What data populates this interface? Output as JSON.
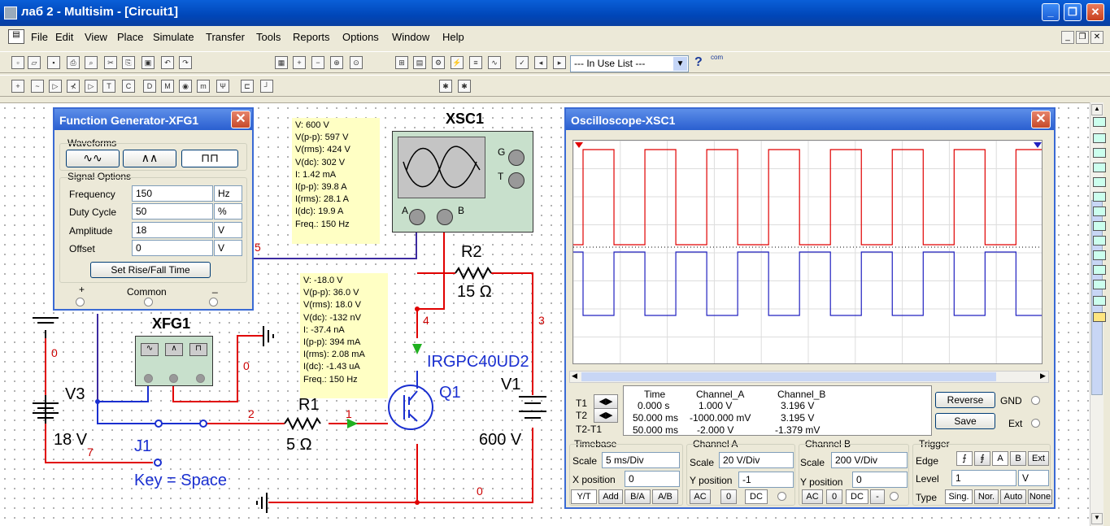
{
  "app": {
    "title": "лаб 2 - Multisim - [Circuit1]"
  },
  "menu": [
    "File",
    "Edit",
    "View",
    "Place",
    "Simulate",
    "Transfer",
    "Tools",
    "Reports",
    "Options",
    "Window",
    "Help"
  ],
  "toolbar": {
    "in_use_list": "--- In Use List ---",
    "help": "?",
    "com": "com"
  },
  "fg": {
    "title": "Function Generator-XFG1",
    "waveforms_label": "Waveforms",
    "signal_options_label": "Signal Options",
    "rows": [
      {
        "label": "Frequency",
        "value": "150",
        "unit": "Hz"
      },
      {
        "label": "Duty Cycle",
        "value": "50",
        "unit": "%"
      },
      {
        "label": "Amplitude",
        "value": "18",
        "unit": "V"
      },
      {
        "label": "Offset",
        "value": "0",
        "unit": "V"
      }
    ],
    "rise_fall": "Set Rise/Fall Time",
    "plus": "+",
    "common": "Common",
    "minus": "_"
  },
  "probe1": [
    "V: 600 V",
    "V(p-p): 597 V",
    "V(rms): 424 V",
    "V(dc): 302 V",
    "I: 1.42 mA",
    "I(p-p): 39.8 A",
    "I(rms): 28.1 A",
    "I(dc): 19.9 A",
    "Freq.: 150 Hz"
  ],
  "probe2": [
    "V: -18.0 V",
    "V(p-p): 36.0 V",
    "V(rms): 18.0 V",
    "V(dc): -132 nV",
    "I: -37.4 nA",
    "I(p-p): 394 mA",
    "I(rms): 2.08 mA",
    "I(dc): -1.43 uA",
    "Freq.: 150 Hz"
  ],
  "circuit": {
    "xsc1": "XSC1",
    "g": "G",
    "t": "T",
    "a": "A",
    "b": "B",
    "r2": "R2",
    "r2v": "15 Ω",
    "xfg1": "XFG1",
    "r1": "R1",
    "r1v": "5 Ω",
    "v3": "V3",
    "v3v": "18 V",
    "v1": "V1",
    "v1v": "600 V",
    "j1": "J1",
    "key": "Key = Space",
    "q1": "Q1",
    "q1model": "IRGPC40UD2",
    "nodes": {
      "n5": "5",
      "n4": "4",
      "n3": "3",
      "n0a": "0",
      "n0b": "0",
      "n0c": "0",
      "n2": "2",
      "n1": "1",
      "n7": "7"
    }
  },
  "scope": {
    "title": "Oscilloscope-XSC1",
    "headers": [
      "Time",
      "Channel_A",
      "Channel_B"
    ],
    "rows": [
      {
        "label": "T1",
        "time": "0.000 s",
        "a": "1.000 V",
        "b": "3.196 V"
      },
      {
        "label": "T2",
        "time": "50.000 ms",
        "a": "-1000.000 mV",
        "b": "3.195 V"
      },
      {
        "label": "T2-T1",
        "time": "50.000 ms",
        "a": "-2.000 V",
        "b": "-1.379 mV"
      }
    ],
    "reverse": "Reverse",
    "save": "Save",
    "gnd": "GND",
    "ext": "Ext",
    "timebase": {
      "label": "Timebase",
      "scale_label": "Scale",
      "scale": "5 ms/Div",
      "xpos_label": "X position",
      "xpos": "0",
      "buttons": [
        "Y/T",
        "Add",
        "B/A",
        "A/B"
      ]
    },
    "cha": {
      "label": "Channel A",
      "scale_label": "Scale",
      "scale": "20  V/Div",
      "ypos_label": "Y position",
      "ypos": "-1",
      "buttons": [
        "AC",
        "0",
        "DC"
      ]
    },
    "chb": {
      "label": "Channel B",
      "scale_label": "Scale",
      "scale": "200  V/Div",
      "ypos_label": "Y position",
      "ypos": "0",
      "buttons": [
        "AC",
        "0",
        "DC",
        "-"
      ]
    },
    "trigger": {
      "label": "Trigger",
      "edge_label": "Edge",
      "edge_buttons": [
        "A",
        "B",
        "Ext"
      ],
      "level_label": "Level",
      "level": "1",
      "level_unit": "V",
      "type_label": "Type",
      "types": [
        "Sing.",
        "Nor.",
        "Auto",
        "None"
      ]
    },
    "colors": {
      "channel_a": "#e00000",
      "channel_b": "#2020c0"
    }
  }
}
